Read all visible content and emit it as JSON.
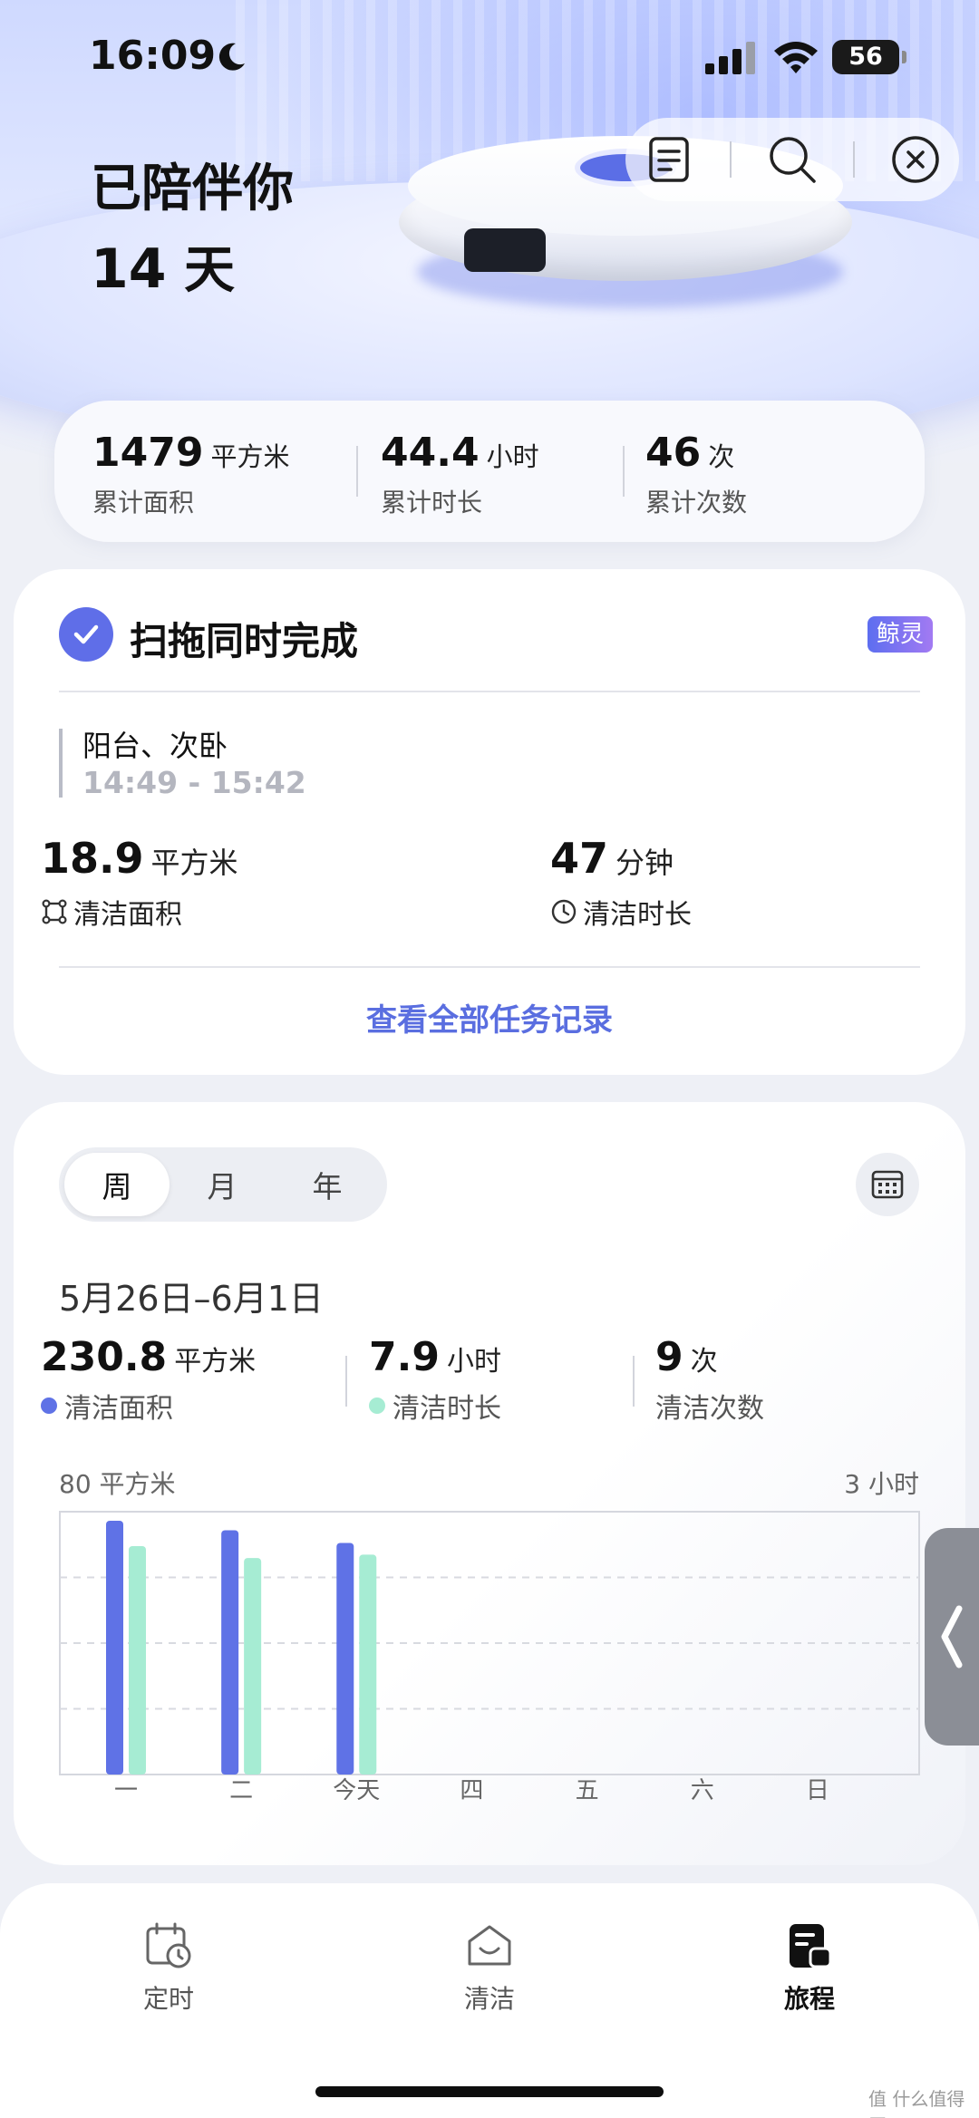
{
  "status_bar": {
    "time": "16:09",
    "battery": "56"
  },
  "hero": {
    "companion_line1": "已陪伴你",
    "companion_days": "14",
    "companion_days_unit": "天"
  },
  "summary": [
    {
      "value": "1479",
      "unit": "平方米",
      "label": "累计面积"
    },
    {
      "value": "44.4",
      "unit": "小时",
      "label": "累计时长"
    },
    {
      "value": "46",
      "unit": "次",
      "label": "累计次数"
    }
  ],
  "task": {
    "title": "扫拖同时完成",
    "badge": "鲸灵",
    "rooms": "阳台、次卧",
    "time_range": "14:49 - 15:42",
    "area_value": "18.9",
    "area_unit": "平方米",
    "area_label": "清洁面积",
    "duration_value": "47",
    "duration_unit": "分钟",
    "duration_label": "清洁时长",
    "view_all": "查看全部任务记录"
  },
  "period_tabs": {
    "week": "周",
    "month": "月",
    "year": "年"
  },
  "week": {
    "date_range": "5月26日–6月1日",
    "area_value": "230.8",
    "area_unit": "平方米",
    "area_label": "清洁面积",
    "duration_value": "7.9",
    "duration_unit": "小时",
    "duration_label": "清洁时长",
    "count_value": "9",
    "count_unit": "次",
    "count_label": "清洁次数"
  },
  "colors": {
    "area": "#5f72e6",
    "duration": "#a6ecd3",
    "accent": "#5a6ee0"
  },
  "chart_data": {
    "type": "bar",
    "categories": [
      "一",
      "二",
      "今天",
      "四",
      "五",
      "六",
      "日"
    ],
    "left_axis_label": "80 平方米",
    "right_axis_label": "3 小时",
    "ylim_left": [
      0,
      80
    ],
    "ylim_right": [
      0,
      3
    ],
    "series": [
      {
        "key": "area",
        "axis": "left",
        "values": [
          80,
          77,
          73,
          0,
          0,
          0,
          0
        ]
      },
      {
        "key": "duration",
        "axis": "right",
        "values": [
          2.7,
          2.56,
          2.6,
          0,
          0,
          0,
          0
        ]
      }
    ],
    "grid": true
  },
  "nav": {
    "schedule": "定时",
    "clean": "清洁",
    "journey": "旅程"
  },
  "watermark": "值 什么值得买"
}
